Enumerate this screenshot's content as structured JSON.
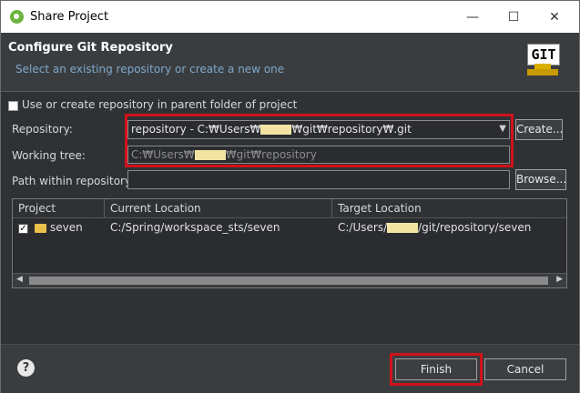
{
  "window": {
    "title": "Share Project",
    "minimize": "—",
    "maximize": "☐",
    "close": "✕"
  },
  "header": {
    "title": "Configure Git Repository",
    "subtitle": "Select an existing repository or create a new one",
    "logo_text": "GIT"
  },
  "form": {
    "parent_folder_label": "Use or create repository in parent folder of project",
    "repository_label": "Repository:",
    "repository_value_prefix": "repository - C:₩Users₩",
    "repository_value_suffix": "₩git₩repository₩.git",
    "create_button": "Create...",
    "working_tree_label": "Working tree:",
    "working_tree_prefix": "C:₩Users₩",
    "working_tree_suffix": "₩git₩repository",
    "path_label": "Path within repository:",
    "path_value": "",
    "browse_button": "Browse..."
  },
  "table": {
    "columns": [
      "Project",
      "Current Location",
      "Target Location"
    ],
    "rows": [
      {
        "checked": true,
        "project": "seven",
        "current": "C:/Spring/workspace_sts/seven",
        "target_prefix": "C:/Users/",
        "target_suffix": "/git/repository/seven"
      }
    ]
  },
  "footer": {
    "help": "?",
    "finish": "Finish",
    "cancel": "Cancel"
  },
  "colors": {
    "accent_red": "#d0121b",
    "subtitle_blue": "#7fa7c9",
    "redacted": "#f3e3a3"
  }
}
